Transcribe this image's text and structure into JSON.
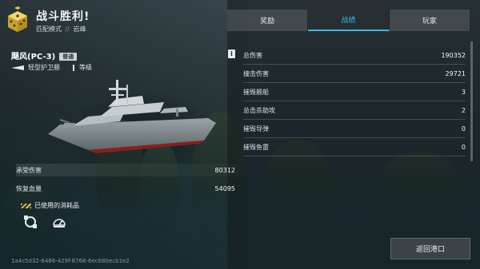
{
  "header": {
    "title": "战斗胜利!",
    "mode": "匹配模式",
    "separator": "//",
    "map": "岩峰"
  },
  "tabs": [
    {
      "label": "奖励",
      "active": false
    },
    {
      "label": "战绩",
      "active": true
    },
    {
      "label": "玩家",
      "active": false
    }
  ],
  "ship": {
    "name": "飓风(PC-3)",
    "rarity": "普通",
    "type": "轻型护卫舰",
    "level_label": "等级",
    "info_icon": "i"
  },
  "left_stats": [
    {
      "label": "承受伤害",
      "value": "80312"
    },
    {
      "label": "恢复血量",
      "value": "54095"
    }
  ],
  "consumables": {
    "title": "已使用的消耗品",
    "items": [
      "repair-icon",
      "radar-icon"
    ]
  },
  "right_stats": [
    {
      "label": "总伤害",
      "value": "190352"
    },
    {
      "label": "撞击伤害",
      "value": "29721"
    },
    {
      "label": "摧毁舰船",
      "value": "3"
    },
    {
      "label": "总击杀助攻",
      "value": "2"
    },
    {
      "label": "摧毁导弹",
      "value": "0"
    },
    {
      "label": "摧毁鱼雷",
      "value": "0"
    }
  ],
  "return_button": "返回港口",
  "match_id": "1a4c5d32-6486-429f-8768-6ec680ecb1e2",
  "colors": {
    "accent": "#3fb6e8",
    "dice": "#e7c34a"
  }
}
